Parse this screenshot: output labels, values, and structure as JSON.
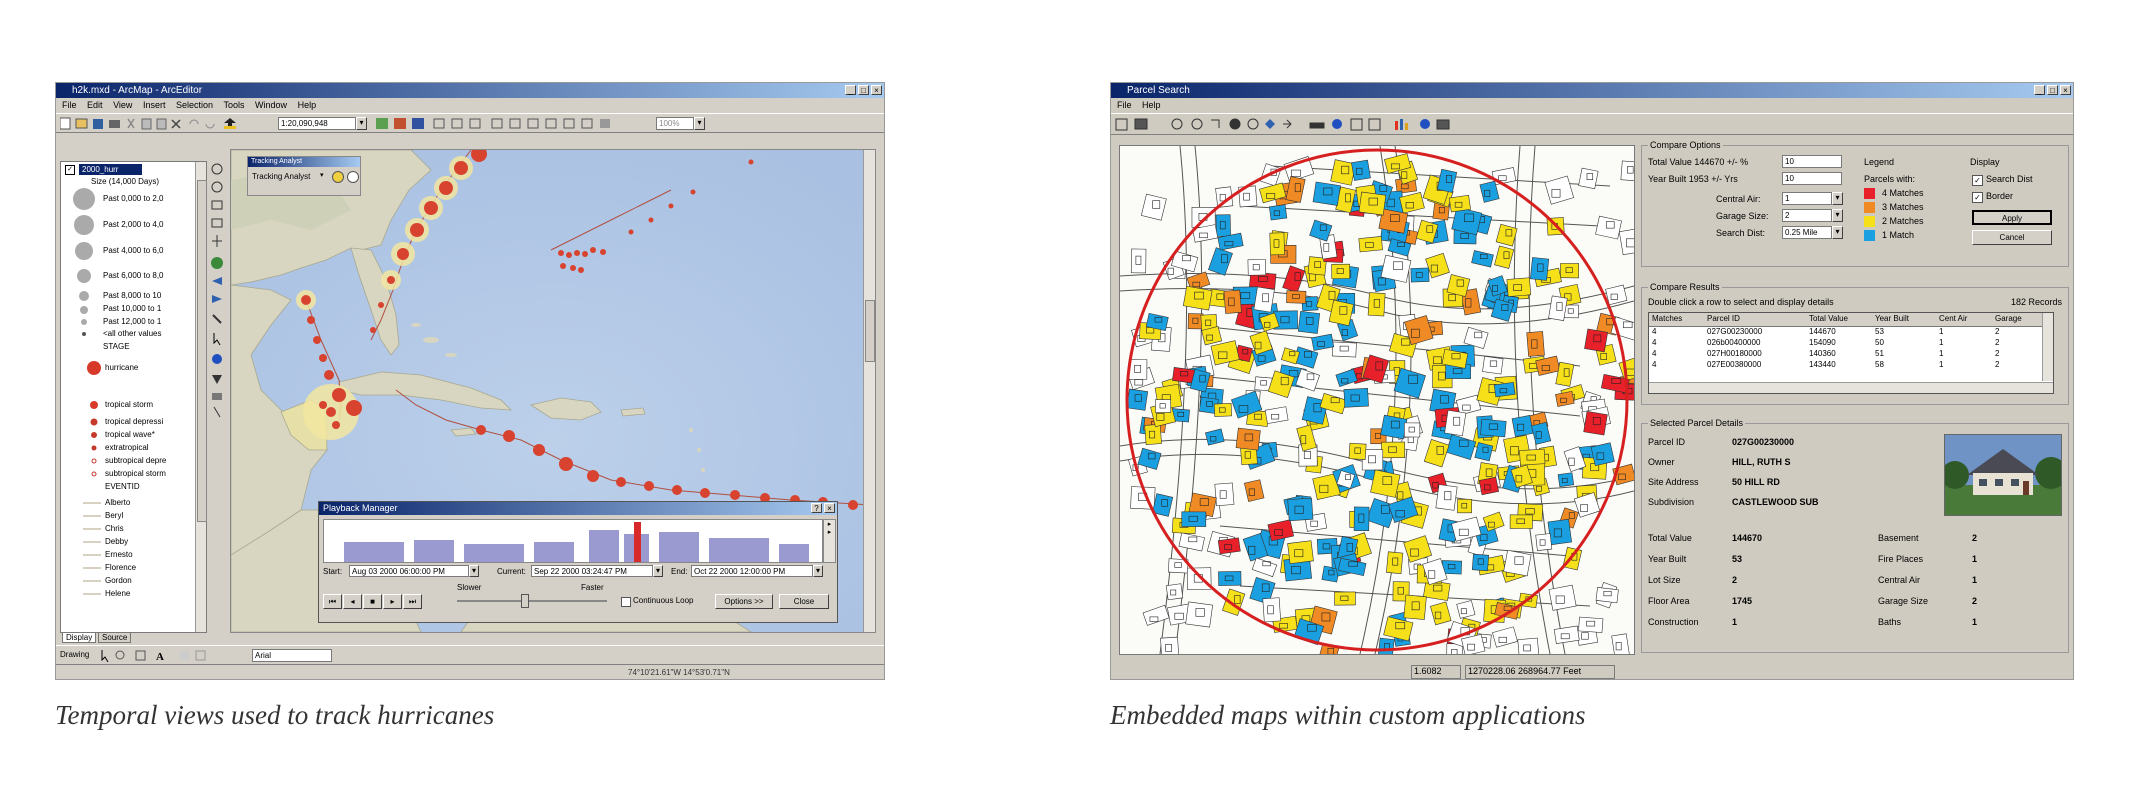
{
  "left": {
    "window_title": "h2k.mxd - ArcMap - ArcEditor",
    "menu": [
      "File",
      "Edit",
      "View",
      "Insert",
      "Selection",
      "Tools",
      "Window",
      "Help"
    ],
    "scale": "1:20,090,948",
    "zoom": "100%",
    "toc": {
      "layer": "2000_hurr",
      "size_label": "Size (14,000 Days)",
      "items": [
        "Past 0,000 to 2,0",
        "Past 2,000 to 4,0",
        "Past 4,000 to 6,0",
        "Past 6,000 to 8,0",
        "Past 8,000 to 10",
        "Past 10,000 to 1",
        "Past 12,000 to 1",
        "<all other values"
      ],
      "stage_label": "STAGE",
      "stage_items": [
        "hurricane",
        "tropical storm",
        "tropical depressi",
        "tropical wave*",
        "extratropical",
        "subtropical depre",
        "subtropical storm"
      ],
      "evento_label": "EVENTID",
      "storms": [
        "Alberto",
        "Beryl",
        "Chris",
        "Debby",
        "Ernesto",
        "Florence",
        "Gordon",
        "Helene"
      ],
      "tabs": [
        "Display",
        "Source"
      ]
    },
    "tracking_analyst": {
      "title": "Tracking Analyst",
      "menu": "Tracking Analyst"
    },
    "playback": {
      "title": "Playback Manager",
      "start_label": "Start:",
      "start_value": "Aug 03 2000 06:00:00 PM",
      "current_label": "Current:",
      "current_value": "Sep 22 2000 03:24:47 PM",
      "end_label": "End:",
      "end_value": "Oct 22 2000 12:00:00 PM",
      "slower": "Slower",
      "faster": "Faster",
      "loop_label": "Continuous Loop",
      "options": "Options >>",
      "close": "Close"
    },
    "drawing": {
      "label": "Drawing",
      "font": "Arial"
    },
    "coords": "74°10'21.61\"W 14°53'0.71\"N"
  },
  "right": {
    "window_title": "Parcel Search",
    "menu": [
      "File",
      "Help"
    ],
    "compare_options": {
      "title": "Compare Options",
      "total_value_label": "Total Value 144670 +/- %",
      "total_value": "10",
      "year_built_label": "Year Built 1953 +/- Yrs",
      "year_built": "10",
      "central_air_label": "Central Air:",
      "central_air": "1",
      "garage_label": "Garage Size:",
      "garage": "2",
      "search_dist_label": "Search Dist:",
      "search_dist": "0.25 Mile"
    },
    "legend": {
      "title": "Legend",
      "subtitle": "Parcels with:",
      "items": [
        {
          "label": "4 Matches",
          "color": "#e8202a"
        },
        {
          "label": "3 Matches",
          "color": "#f08a24"
        },
        {
          "label": "2 Matches",
          "color": "#f5e01a"
        },
        {
          "label": "1 Match",
          "color": "#1aa0e0"
        }
      ]
    },
    "display": {
      "title": "Display",
      "search_dist": "Search Dist",
      "border": "Border",
      "button1": "Apply",
      "button2": "Cancel"
    },
    "results": {
      "title": "Compare Results",
      "instruction": "Double click a row to select and display details",
      "count": "182 Records",
      "columns": [
        "Matches",
        "Parcel ID",
        "Total Value",
        "Year Built",
        "Cent Air",
        "Garage"
      ],
      "rows": [
        [
          "4",
          "027G00230000",
          "144670",
          "53",
          "1",
          "2"
        ],
        [
          "4",
          "026b00400000",
          "154090",
          "50",
          "1",
          "2"
        ],
        [
          "4",
          "027H00180000",
          "140360",
          "51",
          "1",
          "2"
        ],
        [
          "4",
          "027E00380000",
          "143440",
          "58",
          "1",
          "2"
        ]
      ]
    },
    "details": {
      "title": "Selected Parcel Details",
      "parcel_id_label": "Parcel ID",
      "parcel_id": "027G00230000",
      "owner_label": "Owner",
      "owner": "HILL, RUTH S",
      "address_label": "Site Address",
      "address": "50 HILL RD",
      "subdivision_label": "Subdivision",
      "subdivision": "CASTLEWOOD SUB",
      "left_fields": [
        {
          "label": "Total Value",
          "value": "144670"
        },
        {
          "label": "Year Built",
          "value": "53"
        },
        {
          "label": "Lot Size",
          "value": "2"
        },
        {
          "label": "Floor Area",
          "value": "1745"
        },
        {
          "label": "Construction",
          "value": "1"
        }
      ],
      "right_fields": [
        {
          "label": "Basement",
          "value": "2"
        },
        {
          "label": "Fire Places",
          "value": "1"
        },
        {
          "label": "Central Air",
          "value": "1"
        },
        {
          "label": "Garage Size",
          "value": "2"
        },
        {
          "label": "Baths",
          "value": "1"
        }
      ]
    },
    "status": {
      "scale": "1.6082",
      "coords": "1270228.06 268964.77 Feet"
    }
  },
  "captions": {
    "left": "Temporal views used to track hurricanes",
    "right": "Embedded maps within custom applications"
  }
}
